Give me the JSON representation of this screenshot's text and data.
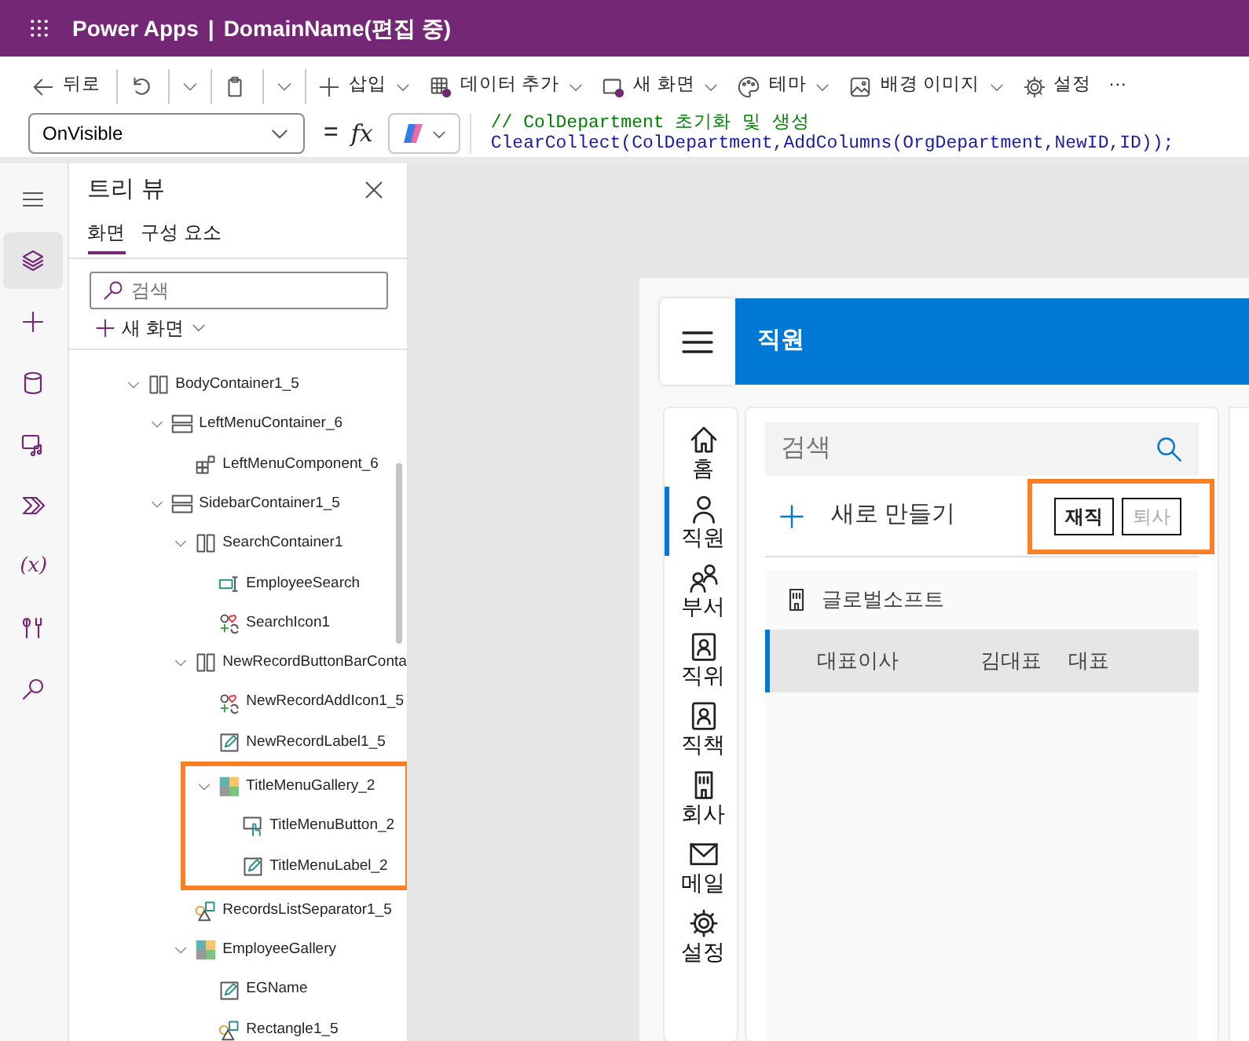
{
  "title_bar": {
    "app": "Power Apps",
    "separator": "|",
    "document": "DomainName(편집 중)"
  },
  "toolbar": {
    "groups": [
      [
        {
          "kind": "back",
          "label": "뒤로"
        }
      ],
      [
        {
          "kind": "undo",
          "split": true
        }
      ],
      [
        {
          "kind": "paste",
          "split": true
        }
      ],
      [
        {
          "kind": "insert",
          "label": "삽입",
          "dropdown": true
        },
        {
          "kind": "data",
          "label": "데이터 추가",
          "dropdown": true
        },
        {
          "kind": "screen",
          "label": "새 화면",
          "dropdown": true
        },
        {
          "kind": "theme",
          "label": "테마",
          "dropdown": true
        },
        {
          "kind": "background",
          "label": "배경 이미지",
          "dropdown": true
        },
        {
          "kind": "settings",
          "label": "설정"
        },
        {
          "kind": "more",
          "label": "···"
        }
      ]
    ]
  },
  "formula_bar": {
    "property": "OnVisible",
    "equals": "=",
    "fx": "fx",
    "code": [
      {
        "kind": "comment",
        "text": "// ColDepartment 초기화 및 생성"
      },
      {
        "kind": "code",
        "text": "ClearCollect(ColDepartment,AddColumns(OrgDepartment,NewID,ID));"
      }
    ]
  },
  "rail": [
    {
      "kind": "layers",
      "selected": true
    },
    {
      "kind": "insert",
      "selected": false
    },
    {
      "kind": "data",
      "selected": false
    },
    {
      "kind": "media",
      "selected": false
    },
    {
      "kind": "flow",
      "selected": false
    },
    {
      "kind": "variables",
      "text": "(x)",
      "selected": false
    },
    {
      "kind": "tools",
      "selected": false
    },
    {
      "kind": "search",
      "selected": false
    }
  ],
  "tree_view": {
    "title": "트리 뷰",
    "tabs": [
      {
        "label": "화면",
        "selected": true
      },
      {
        "label": "구성 요소",
        "selected": false
      }
    ],
    "search": {
      "placeholder": "검색"
    },
    "new_screen": "새 화면",
    "nodes": [
      {
        "label": "BodyContainer1_5",
        "kind": "hcontainer",
        "expanded": true,
        "children": [
          {
            "label": "LeftMenuContainer_6",
            "kind": "vcontainer",
            "expanded": true,
            "children": [
              {
                "label": "LeftMenuComponent_6",
                "kind": "component"
              }
            ]
          },
          {
            "label": "SidebarContainer1_5",
            "kind": "vcontainer",
            "expanded": true,
            "children": [
              {
                "label": "SearchContainer1",
                "kind": "hcontainer",
                "expanded": true,
                "children": [
                  {
                    "label": "EmployeeSearch",
                    "kind": "input"
                  },
                  {
                    "label": "SearchIcon1",
                    "kind": "icon"
                  }
                ]
              },
              {
                "label": "NewRecordButtonBarConta",
                "kind": "hcontainer",
                "expanded": true,
                "children": [
                  {
                    "label": "NewRecordAddIcon1_5",
                    "kind": "icon"
                  },
                  {
                    "label": "NewRecordLabel1_5",
                    "kind": "label"
                  },
                  {
                    "label": "TitleMenuGallery_2",
                    "kind": "gallery",
                    "expanded": true,
                    "highlighted": true,
                    "children": [
                      {
                        "label": "TitleMenuButton_2",
                        "kind": "button"
                      },
                      {
                        "label": "TitleMenuLabel_2",
                        "kind": "label"
                      }
                    ]
                  }
                ]
              },
              {
                "label": "RecordsListSeparator1_5",
                "kind": "rectangle"
              },
              {
                "label": "EmployeeGallery",
                "kind": "gallery",
                "expanded": true,
                "children": [
                  {
                    "label": "EGName",
                    "kind": "label"
                  },
                  {
                    "label": "Rectangle1_5",
                    "kind": "rectangle"
                  }
                ]
              }
            ]
          }
        ]
      }
    ]
  },
  "app": {
    "header_title": "직원",
    "nav": [
      {
        "kind": "home",
        "label": "홈",
        "selected": false
      },
      {
        "kind": "person",
        "label": "직원",
        "selected": true
      },
      {
        "kind": "people",
        "label": "부서",
        "selected": false
      },
      {
        "kind": "contact",
        "label": "직위",
        "selected": false
      },
      {
        "kind": "contact",
        "label": "직책",
        "selected": false
      },
      {
        "kind": "building",
        "label": "회사",
        "selected": false
      },
      {
        "kind": "mail",
        "label": "메일",
        "selected": false
      },
      {
        "kind": "settings",
        "label": "설정",
        "selected": false
      }
    ],
    "search": {
      "placeholder": "검색"
    },
    "new_record": "새로 만들기",
    "filters_highlighted": true,
    "filters": [
      {
        "label": "재직",
        "selected": true
      },
      {
        "label": "퇴사",
        "selected": false
      }
    ],
    "gallery": {
      "company": "글로벌소프트",
      "rows": [
        {
          "cells": [
            "대표이사",
            "김대표",
            "대표"
          ],
          "selected": true
        }
      ]
    }
  }
}
